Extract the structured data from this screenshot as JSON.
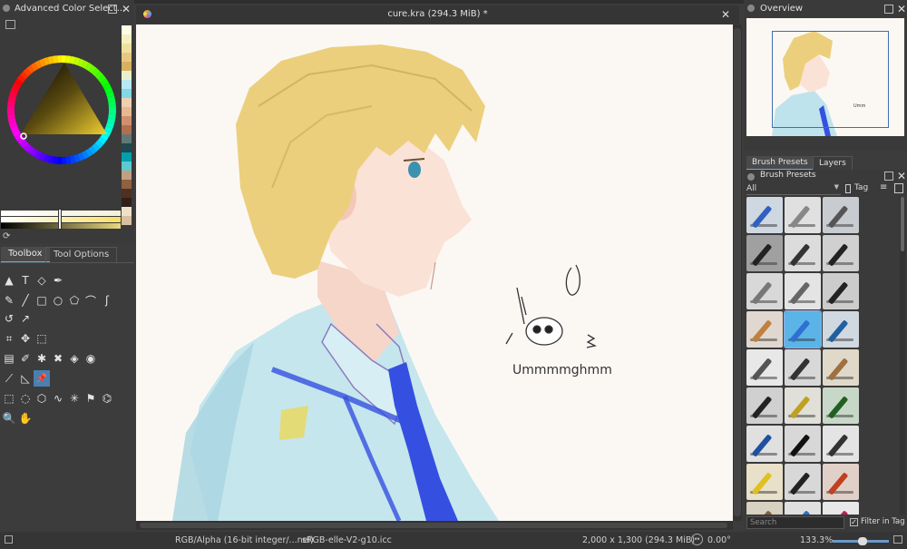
{
  "color_selector": {
    "title": "Advanced Color Select...",
    "swatches": [
      "#fdfde8",
      "#f4f0c0",
      "#f0e0a0",
      "#e8c880",
      "#d8b060",
      "#e8f0d0",
      "#b8e8f0",
      "#80d8e8",
      "#f0d0b0",
      "#e8b890",
      "#d09070",
      "#b07050",
      "#607878",
      "#204850",
      "#00a0b0",
      "#60c8d0",
      "#c0a080",
      "#906040",
      "#503020",
      "#302018",
      "#f0e0c8",
      "#d8c0a0"
    ]
  },
  "toolbox_tabs": {
    "toolbox": "Toolbox",
    "tool_options": "Tool Options"
  },
  "canvas": {
    "title": "cure.kra (294.3 MiB) *",
    "doodle_text": "Ummmmghmm"
  },
  "overview": {
    "title": "Overview"
  },
  "right_tabs": {
    "brush_presets": "Brush Presets",
    "layers": "Layers"
  },
  "brush_presets": {
    "title": "Brush Presets",
    "filter": "All",
    "tag_label": "Tag",
    "search_placeholder": "Search",
    "filter_in_tag": "Filter in Tag"
  },
  "status": {
    "color_space": "RGB/Alpha (16-bit integer/...nel)",
    "profile": "sRGB-elle-V2-g10.icc",
    "size": "2,000 x 1,300 (294.3 MiB)",
    "rotation": "0.00°",
    "zoom": "133.3%"
  },
  "colors": {
    "accent": "#5ab4e8",
    "panel_bg": "#3c3c3c",
    "canvas_bg": "#fbf8f4"
  }
}
